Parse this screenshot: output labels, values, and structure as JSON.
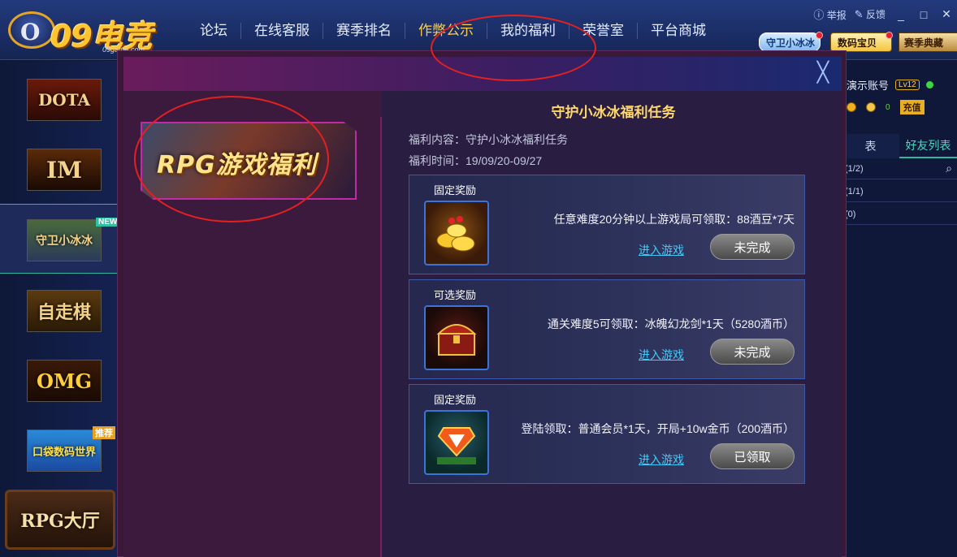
{
  "header": {
    "logo": {
      "mark": "O",
      "brand": "09电竞",
      "url": "09game.com"
    },
    "nav": [
      "论坛",
      "在线客服",
      "赛季排名",
      "作弊公示",
      "我的福利",
      "荣誉室",
      "平台商城"
    ],
    "window": {
      "report": "举报",
      "feedback": "反馈",
      "minimize": "_",
      "maximize": "□",
      "close": "✕"
    },
    "promos": [
      "守卫小冰冰",
      "数码宝贝",
      "赛季典藏"
    ]
  },
  "sidebar": {
    "games": [
      {
        "label": "DOTA"
      },
      {
        "label": "IM"
      },
      {
        "label": "守卫小冰冰",
        "badge": "NEW"
      },
      {
        "label": "自走棋"
      },
      {
        "label": "OMG"
      },
      {
        "label": "口袋数码世界",
        "badge": "推荐"
      }
    ],
    "hall": "RPG大厅"
  },
  "right_panel": {
    "account": "演示账号",
    "level": "Lv12",
    "balance": "0",
    "charge": "充值",
    "tabs": [
      "表",
      "好友列表"
    ],
    "groups": [
      "(1/2)",
      "(1/1)",
      "(0)"
    ]
  },
  "dialog": {
    "close": "╳",
    "banner": "RPG游戏福利",
    "task_title": "守护小冰冰福利任务",
    "content_label": "福利内容：守护小冰冰福利任务",
    "time_label": "福利时间：19/09/20-09/27",
    "rewards": [
      {
        "type": "固定奖励",
        "icon": "gold-ingots-icon",
        "desc": "任意难度20分钟以上游戏局可领取：88酒豆*7天",
        "link": "进入游戏",
        "status": "未完成"
      },
      {
        "type": "可选奖励",
        "icon": "treasure-chest-icon",
        "desc": "通关难度5可领取：冰魄幻龙剑*1天（5280酒币）",
        "link": "进入游戏",
        "status": "未完成"
      },
      {
        "type": "固定奖励",
        "icon": "vip-badge-icon",
        "desc": "登陆领取：普通会员*1天，开局+10w金币（200酒币）",
        "link": "进入游戏",
        "status": "已领取"
      }
    ]
  },
  "colors": {
    "accent": "#ffd86a",
    "link": "#45c9f7",
    "highlight": "#e42020"
  }
}
